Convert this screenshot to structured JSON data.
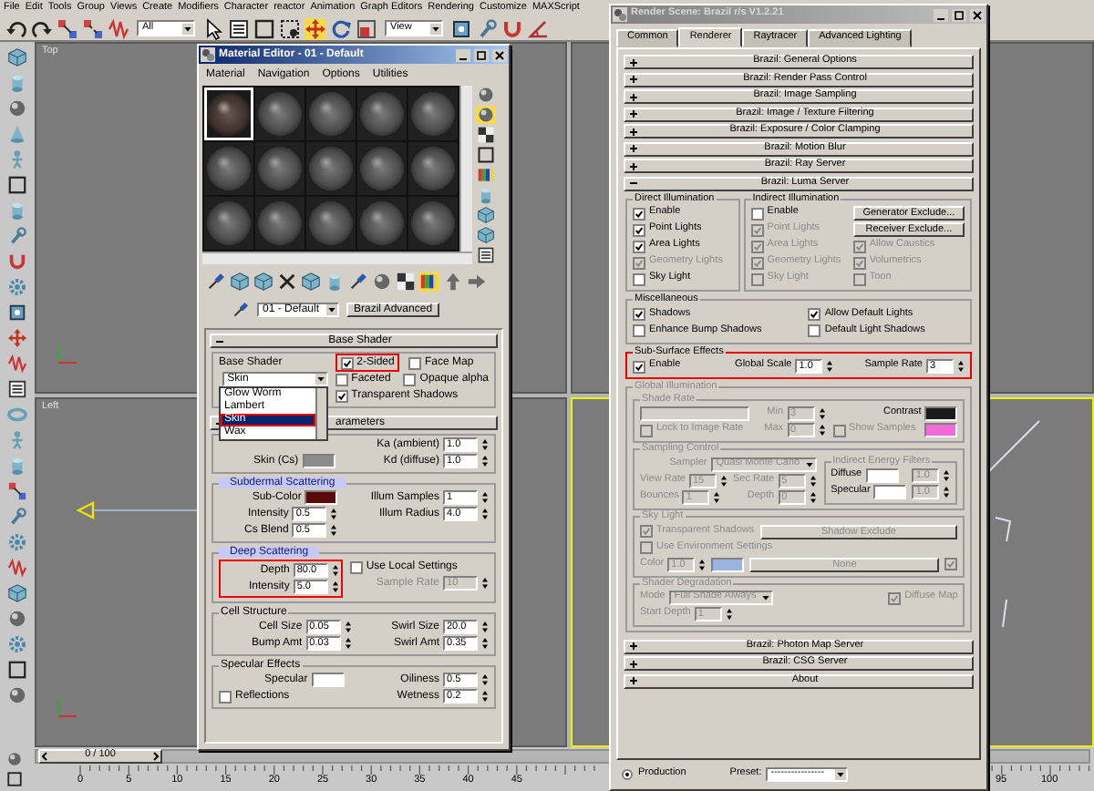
{
  "menu_bar": [
    "File",
    "Edit",
    "Tools",
    "Group",
    "Views",
    "Create",
    "Modifiers",
    "Character",
    "reactor",
    "Animation",
    "Graph Editors",
    "Rendering",
    "Customize",
    "MAXScript"
  ],
  "toolbar": {
    "tools": [
      {
        "selected": false
      },
      {
        "selected": false
      },
      {
        "selected": false
      },
      {
        "selected": false
      },
      {
        "selected": false
      },
      {
        "selected": false
      },
      {
        "selected": false
      },
      {
        "selected": false
      },
      {
        "selected": false
      },
      {
        "selected": true
      },
      {
        "selected": false
      },
      {
        "selected": false
      },
      {
        "selected": false
      },
      {
        "selected": false
      },
      {
        "selected": false
      },
      {
        "selected": false
      }
    ],
    "selection_filter": "All",
    "reference_coordinates": "View"
  },
  "viewports": [
    {
      "label": "Top",
      "active": false
    },
    {
      "active": false
    },
    {
      "label": "Left",
      "active": false
    },
    {
      "active": true
    }
  ],
  "time_slider": {
    "frame": "0 / 100"
  },
  "track_bar": {
    "ticks_start": [
      "0",
      "5",
      "10",
      "15",
      "20",
      "25",
      "30",
      "35",
      "40",
      "45"
    ],
    "ticks_end": [
      "95",
      "100"
    ]
  },
  "material_editor": {
    "title": "Material Editor - 01 - Default",
    "active": true,
    "menu": [
      "Material",
      "Navigation",
      "Options",
      "Utilities"
    ],
    "slots": [
      {
        "selected": true
      },
      {
        "selected": false
      },
      {
        "selected": false
      },
      {
        "selected": false
      },
      {
        "selected": false
      },
      {
        "selected": false
      },
      {
        "selected": false
      },
      {
        "selected": false
      },
      {
        "selected": false
      },
      {
        "selected": false
      },
      {
        "selected": false
      },
      {
        "selected": false
      },
      {
        "selected": false
      },
      {
        "selected": false
      },
      {
        "selected": false
      }
    ],
    "side_tools": [
      {
        "selected": false
      },
      {
        "selected": true
      },
      {
        "selected": false
      },
      {
        "selected": false
      },
      {
        "selected": false
      },
      {
        "selected": false
      },
      {
        "selected": false
      },
      {
        "selected": false
      },
      {
        "selected": false
      }
    ],
    "bottom_tools": [
      {
        "selected": false
      },
      {
        "selected": false
      },
      {
        "selected": false
      },
      {
        "selected": false
      },
      {
        "selected": false
      },
      {
        "selected": false
      },
      {
        "selected": false
      },
      {
        "selected": false
      },
      {
        "selected": false
      },
      {
        "selected": true
      },
      {
        "selected": false
      },
      {
        "selected": false
      }
    ],
    "material_name": "01 - Default",
    "material_type": "Brazil Advanced",
    "rollouts": [
      {
        "title": "Base Shader",
        "expanded": true,
        "rows": [
          [
            {
              "highlighted": false,
              "columns": [
                {
                  "items": [
                    {
                      "kind": "text",
                      "label": "Base Shader"
                    },
                    {
                      "kind": "dropdown",
                      "value": "Skin",
                      "disabled": false,
                      "list": [
                        {
                          "label": "Glow Worm",
                          "selected": false
                        },
                        {
                          "label": "Lambert",
                          "selected": false
                        },
                        {
                          "label": "Skin",
                          "selected": true
                        },
                        {
                          "label": "Wax",
                          "selected": false
                        }
                      ]
                    }
                  ]
                },
                {
                  "items": [
                    {
                      "kind": "pair",
                      "items": [
                        {
                          "kind": "check",
                          "label": "2-Sided",
                          "checked": true,
                          "disabled": false,
                          "highlighted": true
                        },
                        {
                          "kind": "check",
                          "label": "Face Map",
                          "checked": false,
                          "disabled": false,
                          "highlighted": false
                        }
                      ]
                    },
                    {
                      "kind": "pair",
                      "items": [
                        {
                          "kind": "check",
                          "label": "Faceted",
                          "checked": false,
                          "disabled": false,
                          "highlighted": false
                        },
                        {
                          "kind": "check",
                          "label": "Opaque alpha",
                          "checked": false,
                          "disabled": false,
                          "highlighted": false
                        }
                      ]
                    },
                    {
                      "kind": "check",
                      "label": "Transparent Shadows",
                      "checked": true,
                      "disabled": false,
                      "highlighted": false
                    }
                  ]
                }
              ]
            }
          ]
        ]
      },
      {
        "title": "arameters",
        "expanded": true,
        "rows": [
          [
            {
              "highlighted": false,
              "columns": [
                {
                  "items": [
                    {
                      "kind": "swatch",
                      "label": "Skin (Cs)",
                      "color": "#8c8c8c"
                    }
                  ]
                },
                {
                  "items": [
                    {
                      "kind": "spin",
                      "label": "Ka (ambient)",
                      "value": "1.0",
                      "disabled": false
                    },
                    {
                      "kind": "spin",
                      "label": "Kd (diffuse)",
                      "value": "1.0",
                      "disabled": false
                    }
                  ]
                }
              ]
            }
          ],
          [
            {
              "title": "Subdermal Scattering",
              "title_tinted": true,
              "highlighted": false,
              "columns": [
                {
                  "items": [
                    {
                      "kind": "swatch",
                      "label": "Sub-Color",
                      "color": "#5a0a0a"
                    },
                    {
                      "kind": "spin",
                      "label": "Intensity",
                      "value": "0.5",
                      "disabled": false
                    },
                    {
                      "kind": "spin",
                      "label": "Cs Blend",
                      "value": "0.5",
                      "disabled": false
                    }
                  ]
                },
                {
                  "items": [
                    {
                      "kind": "spin",
                      "label": "Illum Samples",
                      "value": "1",
                      "disabled": false
                    },
                    {
                      "kind": "spin",
                      "label": "Illum Radius",
                      "value": "4.0",
                      "disabled": false
                    }
                  ]
                }
              ]
            }
          ],
          [
            {
              "title": "Deep Scattering",
              "title_tinted": true,
              "highlighted": false,
              "columns": [
                {
                  "highlighted": true,
                  "items": [
                    {
                      "kind": "spin",
                      "label": "Depth",
                      "value": "80.0",
                      "disabled": false
                    },
                    {
                      "kind": "spin",
                      "label": "Intensity",
                      "value": "5.0",
                      "disabled": false
                    }
                  ]
                },
                {
                  "highlighted": false,
                  "items": [
                    {
                      "kind": "check",
                      "label": "Use Local Settings",
                      "checked": false,
                      "disabled": false
                    },
                    {
                      "kind": "spin",
                      "label": "Sample Rate",
                      "value": "10",
                      "disabled": true
                    }
                  ]
                }
              ]
            }
          ],
          [
            {
              "title": "Cell Structure",
              "title_tinted": false,
              "highlighted": false,
              "columns": [
                {
                  "items": [
                    {
                      "kind": "spin",
                      "label": "Cell Size",
                      "value": "0.05",
                      "disabled": false
                    },
                    {
                      "kind": "spin",
                      "label": "Bump Amt",
                      "value": "0.03",
                      "disabled": false
                    }
                  ]
                },
                {
                  "items": [
                    {
                      "kind": "spin",
                      "label": "Swirl Size",
                      "value": "20.0",
                      "disabled": false
                    },
                    {
                      "kind": "spin",
                      "label": "Swirl Amt",
                      "value": "0.35",
                      "disabled": false
                    }
                  ]
                }
              ]
            }
          ],
          [
            {
              "title": "Specular Effects",
              "title_tinted": false,
              "highlighted": false,
              "columns": [
                {
                  "items": [
                    {
                      "kind": "swatch",
                      "label": "Specular",
                      "color": "#ffffff"
                    },
                    {
                      "kind": "check",
                      "label": "Reflections",
                      "checked": false,
                      "disabled": false
                    }
                  ]
                },
                {
                  "items": [
                    {
                      "kind": "spin",
                      "label": "Oiliness",
                      "value": "0.5",
                      "disabled": false
                    },
                    {
                      "kind": "spin",
                      "label": "Wetness",
                      "value": "0.2",
                      "disabled": false
                    }
                  ]
                }
              ]
            }
          ]
        ]
      }
    ]
  },
  "render_scene": {
    "title": "Render Scene: Brazil r/s V1.2.21",
    "active": false,
    "tabs": [
      {
        "label": "Common",
        "selected": false
      },
      {
        "label": "Renderer",
        "selected": true
      },
      {
        "label": "Raytracer",
        "selected": false
      },
      {
        "label": "Advanced Lighting",
        "selected": false
      }
    ],
    "rollouts": [
      {
        "title": "Brazil: General Options",
        "expanded": false
      },
      {
        "title": "Brazil: Render Pass Control",
        "expanded": false
      },
      {
        "title": "Brazil: Image Sampling",
        "expanded": false
      },
      {
        "title": "Brazil: Image / Texture Filtering",
        "expanded": false
      },
      {
        "title": "Brazil: Exposure / Color Clamping",
        "expanded": false
      },
      {
        "title": "Brazil: Motion Blur",
        "expanded": false
      },
      {
        "title": "Brazil: Ray Server",
        "expanded": false
      },
      {
        "title": "Brazil: Luma Server",
        "expanded": true,
        "rows": [
          [
            {
              "title": "Direct Illumination",
              "highlighted": false,
              "disabled": false,
              "columns": [
                {
                  "items": [
                    {
                      "kind": "check",
                      "label": "Enable",
                      "checked": true,
                      "disabled": false
                    },
                    {
                      "kind": "check",
                      "label": "Point Lights",
                      "checked": true,
                      "disabled": false
                    },
                    {
                      "kind": "check",
                      "label": "Area Lights",
                      "checked": true,
                      "disabled": false
                    },
                    {
                      "kind": "check",
                      "label": "Geometry Lights",
                      "checked": true,
                      "disabled": true
                    },
                    {
                      "kind": "check",
                      "label": "Sky Light",
                      "checked": false,
                      "disabled": false
                    }
                  ]
                }
              ]
            },
            {
              "title": "Indirect Illumination",
              "highlighted": false,
              "disabled": false,
              "columns": [
                {
                  "items": [
                    {
                      "kind": "check",
                      "label": "Enable",
                      "checked": false,
                      "disabled": false
                    },
                    {
                      "kind": "check",
                      "label": "Point Lights",
                      "checked": true,
                      "disabled": true
                    },
                    {
                      "kind": "check",
                      "label": "Area Lights",
                      "checked": true,
                      "disabled": true
                    },
                    {
                      "kind": "check",
                      "label": "Geometry Lights",
                      "checked": true,
                      "disabled": true
                    },
                    {
                      "kind": "check",
                      "label": "Sky Light",
                      "checked": false,
                      "disabled": true
                    }
                  ]
                },
                {
                  "items": [
                    {
                      "kind": "button",
                      "label": "Generator Exclude...",
                      "disabled": false
                    },
                    {
                      "kind": "button",
                      "label": "Receiver Exclude...",
                      "disabled": false
                    },
                    {
                      "kind": "check",
                      "label": "Allow Caustics",
                      "checked": true,
                      "disabled": true
                    },
                    {
                      "kind": "check",
                      "label": "Volumetrics",
                      "checked": true,
                      "disabled": true
                    },
                    {
                      "kind": "check",
                      "label": "Toon",
                      "checked": false,
                      "disabled": true
                    }
                  ]
                }
              ]
            }
          ],
          [
            {
              "title": "Miscellaneous",
              "highlighted": false,
              "disabled": false,
              "columns": [
                {
                  "items": [
                    {
                      "kind": "check",
                      "label": "Shadows",
                      "checked": true,
                      "disabled": false
                    },
                    {
                      "kind": "check",
                      "label": "Enhance Bump Shadows",
                      "checked": false,
                      "disabled": false
                    }
                  ]
                },
                {
                  "items": [
                    {
                      "kind": "check",
                      "label": "Allow Default Lights",
                      "checked": true,
                      "disabled": false
                    },
                    {
                      "kind": "check",
                      "label": "Default Light Shadows",
                      "checked": false,
                      "disabled": false
                    }
                  ]
                }
              ]
            }
          ],
          [
            {
              "title": "Sub-Surface Effects",
              "highlighted": true,
              "disabled": false,
              "columns": [
                {
                  "items": [
                    {
                      "kind": "check",
                      "label": "Enable",
                      "checked": true,
                      "disabled": false
                    }
                  ]
                },
                {
                  "items": [
                    {
                      "kind": "spin",
                      "label": "Global Scale",
                      "value": "1.0",
                      "disabled": false
                    }
                  ]
                },
                {
                  "items": [
                    {
                      "kind": "spin",
                      "label": "Sample Rate",
                      "value": "3",
                      "disabled": false
                    }
                  ]
                }
              ]
            }
          ],
          [
            {
              "title": "Global Illumination",
              "highlighted": false,
              "disabled": true,
              "columns": [
                {
                  "items": [
                    {
                      "kind": "group",
                      "title": "Shade Rate",
                      "highlighted": false,
                      "disabled": true,
                      "columns": [
                        {
                          "items": [
                            {
                              "kind": "field",
                              "disabled": true
                            },
                            {
                              "kind": "check",
                              "label": "Lock to Image Rate",
                              "checked": false,
                              "disabled": true
                            }
                          ]
                        },
                        {
                          "items": [
                            {
                              "kind": "spin",
                              "label": "Min",
                              "value": "3",
                              "disabled": true
                            },
                            {
                              "kind": "spin",
                              "label": "Max",
                              "value": "0",
                              "disabled": true
                            }
                          ]
                        },
                        {
                          "items": [
                            {
                              "kind": "swatch",
                              "label": "Contrast",
                              "color": "#1a1a1a"
                            },
                            {
                              "kind": "pair",
                              "items": [
                                {
                                  "kind": "check",
                                  "label": "Show Samples",
                                  "checked": false,
                                  "disabled": true
                                },
                                {
                                  "kind": "swatch",
                                  "color": "#f06ad8"
                                }
                              ]
                            }
                          ]
                        }
                      ]
                    },
                    {
                      "kind": "group",
                      "title": "Sampling Control",
                      "highlighted": false,
                      "disabled": true,
                      "columns": [
                        {
                          "items": [
                            {
                              "kind": "dropdown",
                              "label": "Sampler",
                              "value": "Quasi Monte Carlo",
                              "disabled": true
                            },
                            {
                              "kind": "pair",
                              "items": [
                                {
                                  "kind": "spin",
                                  "label": "View Rate",
                                  "value": "15",
                                  "disabled": true
                                },
                                {
                                  "kind": "spin",
                                  "label": "Sec Rate",
                                  "value": "5",
                                  "disabled": true
                                }
                              ]
                            },
                            {
                              "kind": "pair",
                              "items": [
                                {
                                  "kind": "spin",
                                  "label": "Bounces",
                                  "value": "1",
                                  "disabled": true
                                },
                                {
                                  "kind": "spin",
                                  "label": "Depth",
                                  "value": "0",
                                  "disabled": true
                                }
                              ]
                            }
                          ]
                        },
                        {
                          "items": [
                            {
                              "kind": "group",
                              "title": "Indirect Energy Filters",
                              "highlighted": false,
                              "disabled": true,
                              "columns": [
                                {
                                  "items": [
                                    {
                                      "kind": "pair",
                                      "items": [
                                        {
                                          "kind": "swatch",
                                          "label": "Diffuse",
                                          "color": "#ffffff"
                                        },
                                        {
                                          "kind": "spin",
                                          "value": "1.0",
                                          "disabled": true
                                        }
                                      ]
                                    },
                                    {
                                      "kind": "pair",
                                      "items": [
                                        {
                                          "kind": "swatch",
                                          "label": "Specular",
                                          "color": "#ffffff"
                                        },
                                        {
                                          "kind": "spin",
                                          "value": "1.0",
                                          "disabled": true
                                        }
                                      ]
                                    }
                                  ]
                                }
                              ]
                            }
                          ]
                        }
                      ]
                    },
                    {
                      "kind": "group",
                      "title": "Sky Light",
                      "highlighted": false,
                      "disabled": true,
                      "columns": [
                        {
                          "items": [
                            {
                              "kind": "pair",
                              "items": [
                                {
                                  "kind": "check",
                                  "label": "Transparent Shadows",
                                  "checked": true,
                                  "disabled": true
                                },
                                {
                                  "kind": "button",
                                  "label": "Shadow Exclude",
                                  "disabled": true
                                }
                              ]
                            },
                            {
                              "kind": "check",
                              "label": "Use Environment Settings",
                              "checked": false,
                              "disabled": true
                            },
                            {
                              "kind": "pair",
                              "items": [
                                {
                                  "kind": "spin",
                                  "label": "Color",
                                  "value": "1.0",
                                  "disabled": true
                                },
                                {
                                  "kind": "swatch",
                                  "color": "#9ab4e0"
                                },
                                {
                                  "kind": "button",
                                  "label": "None",
                                  "disabled": true
                                },
                                {
                                  "kind": "check",
                                  "checked": true,
                                  "disabled": true
                                }
                              ]
                            }
                          ]
                        }
                      ]
                    },
                    {
                      "kind": "group",
                      "title": "Shader Degradation",
                      "highlighted": false,
                      "disabled": true,
                      "columns": [
                        {
                          "items": [
                            {
                              "kind": "pair",
                              "items": [
                                {
                                  "kind": "dropdown",
                                  "label": "Mode",
                                  "value": "Full Shade Always",
                                  "disabled": true
                                },
                                {
                                  "kind": "check",
                                  "label": "Diffuse Map",
                                  "checked": true,
                                  "disabled": true
                                }
                              ]
                            },
                            {
                              "kind": "pair",
                              "items": [
                                {
                                  "kind": "spin",
                                  "label": "Start Depth",
                                  "value": "1",
                                  "disabled": true
                                }
                              ]
                            }
                          ]
                        }
                      ]
                    }
                  ]
                }
              ]
            }
          ]
        ]
      },
      {
        "title": "Brazil: Photon Map Server",
        "expanded": false
      },
      {
        "title": "Brazil: CSG Server",
        "expanded": false
      },
      {
        "title": "About",
        "expanded": false
      }
    ],
    "mode": {
      "label": "Production",
      "selected": true
    },
    "preset_label": "Preset:",
    "preset": "----------------"
  }
}
